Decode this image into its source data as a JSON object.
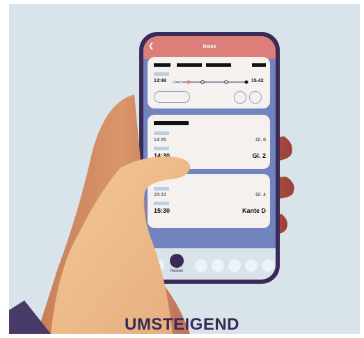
{
  "header": {
    "title": "Reise",
    "back_icon": "chevron-left-icon"
  },
  "trip": {
    "depart": "13:48",
    "arrive": "15.42"
  },
  "leg1": {
    "time1": "14:26",
    "platform1": "Gl. 6",
    "time2": "14:30",
    "platform2": "Gl. 2"
  },
  "leg2": {
    "time1": "15:22",
    "platform1": "Gl. 4",
    "time2": "15:30",
    "platform2": "Kante D"
  },
  "tabbar": {
    "active_label": "Reisen"
  },
  "caption": "UMSTEIGEND",
  "colors": {
    "background": "#d9e3ea",
    "header": "#dc7f7a",
    "phone": "#3a2a56",
    "screen": "#7184c0",
    "hand": "#f0c48c"
  }
}
